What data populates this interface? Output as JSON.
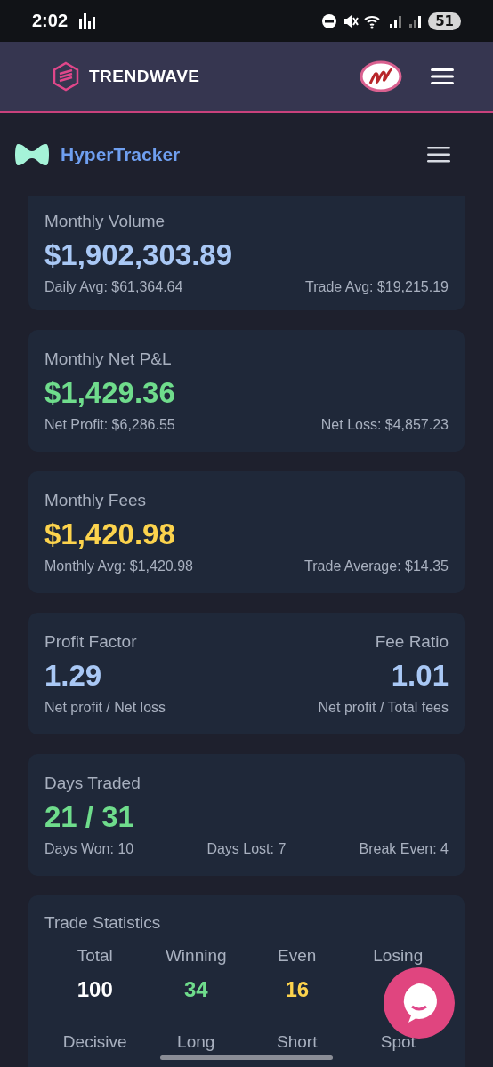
{
  "status_bar": {
    "time": "2:02",
    "battery": "51"
  },
  "app_header": {
    "brand": "TRENDWAVE"
  },
  "nav": {
    "title": "HyperTracker"
  },
  "cards": [
    {
      "kind": "metric",
      "title": "Monthly Volume",
      "value": "$1,902,303.89",
      "color": "#a9c8f5",
      "details": [
        "Daily Avg: $61,364.64",
        "Trade Avg: $19,215.19"
      ]
    },
    {
      "kind": "metric",
      "title": "Monthly Net P&L",
      "value": "$1,429.36",
      "color": "#6fdc8c",
      "details": [
        "Net Profit: $6,286.55",
        "Net Loss: $4,857.23"
      ]
    },
    {
      "kind": "metric",
      "title": "Monthly Fees",
      "value": "$1,420.98",
      "color": "#fcd34d",
      "details": [
        "Monthly Avg: $1,420.98",
        "Trade Average: $14.35"
      ]
    },
    {
      "kind": "pair",
      "columns": [
        {
          "title": "Profit Factor",
          "value": "1.29",
          "color": "#a9c8f5",
          "detail": "Net profit / Net loss"
        },
        {
          "title": "Fee Ratio",
          "value": "1.01",
          "color": "#a9c8f5",
          "detail": "Net profit / Total fees"
        }
      ]
    },
    {
      "kind": "metric",
      "title": "Days Traded",
      "value": "21 / 31",
      "color": "#6fdc8c",
      "details": [
        "Days Won: 10",
        "Days Lost: 7",
        "Break Even: 4"
      ]
    },
    {
      "kind": "stats",
      "title": "Trade Statistics",
      "items": [
        {
          "label": "Total",
          "value": "100",
          "color": "#ffffff"
        },
        {
          "label": "Winning",
          "value": "34",
          "color": "#6fdc8c"
        },
        {
          "label": "Even",
          "value": "16",
          "color": "#fcd34d"
        },
        {
          "label": "Losing"
        },
        {
          "label": "Decisive"
        },
        {
          "label": "Long"
        },
        {
          "label": "Short"
        },
        {
          "label": "Spot"
        }
      ]
    }
  ]
}
